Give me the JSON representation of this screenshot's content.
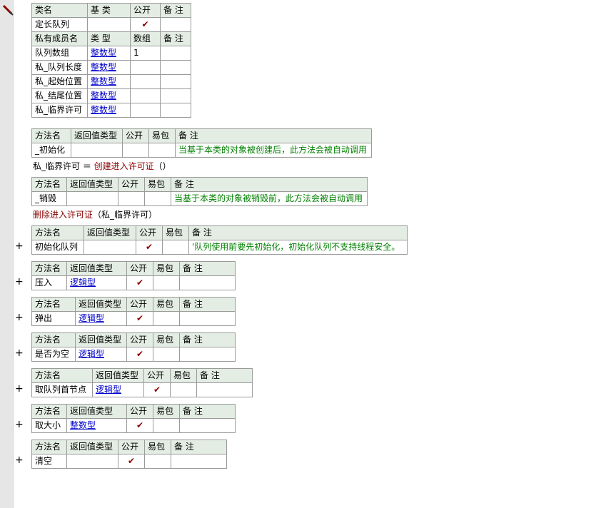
{
  "gutter": {
    "plus": "+"
  },
  "class_table": {
    "headers": [
      "类名",
      "基 类",
      "公开",
      "备 注"
    ],
    "row": {
      "name": "定长队列",
      "base": "",
      "public": "✔",
      "note": ""
    }
  },
  "members_table": {
    "headers": [
      "私有成员名",
      "类 型",
      "数组",
      "备 注"
    ],
    "rows": [
      {
        "name": "队列数组",
        "type": "整数型",
        "array": "1",
        "note": ""
      },
      {
        "name": "私_队列长度",
        "type": "整数型",
        "array": "",
        "note": ""
      },
      {
        "name": "私_起始位置",
        "type": "整数型",
        "array": "",
        "note": ""
      },
      {
        "name": "私_结尾位置",
        "type": "整数型",
        "array": "",
        "note": ""
      },
      {
        "name": "私_临界许可",
        "type": "整数型",
        "array": "",
        "note": ""
      }
    ]
  },
  "method_headers": [
    "方法名",
    "返回值类型",
    "公开",
    "易包",
    "备 注"
  ],
  "methods": [
    {
      "name": "_初始化",
      "ret": "",
      "public": "",
      "easy": "",
      "note": "当基于本类的对象被创建后，此方法会被自动调用"
    },
    {
      "name": "_销毁",
      "ret": "",
      "public": "",
      "easy": "",
      "note": "当基于本类的对象被销毁前，此方法会被自动调用"
    },
    {
      "name": "初始化队列",
      "ret": "",
      "public": "✔",
      "easy": "",
      "note": "'队列使用前要先初始化，初始化队列不支持线程安全。"
    },
    {
      "name": "压入",
      "ret": "逻辑型",
      "public": "✔",
      "easy": "",
      "note": ""
    },
    {
      "name": "弹出",
      "ret": "逻辑型",
      "public": "✔",
      "easy": "",
      "note": ""
    },
    {
      "name": "是否为空",
      "ret": "逻辑型",
      "public": "✔",
      "easy": "",
      "note": ""
    },
    {
      "name": "取队列首节点",
      "ret": "逻辑型",
      "public": "✔",
      "easy": "",
      "note": ""
    },
    {
      "name": "取大小",
      "ret": "整数型",
      "public": "✔",
      "easy": "",
      "note": ""
    },
    {
      "name": "清空",
      "ret": "",
      "public": "✔",
      "easy": "",
      "note": ""
    }
  ],
  "code": {
    "line1": {
      "var": "私_临界许可",
      "op": " ＝ ",
      "fn": "创建进入许可证",
      "args": "（）"
    },
    "line2": {
      "fn": "删除进入许可证",
      "args": "（私_临界许可）"
    }
  }
}
